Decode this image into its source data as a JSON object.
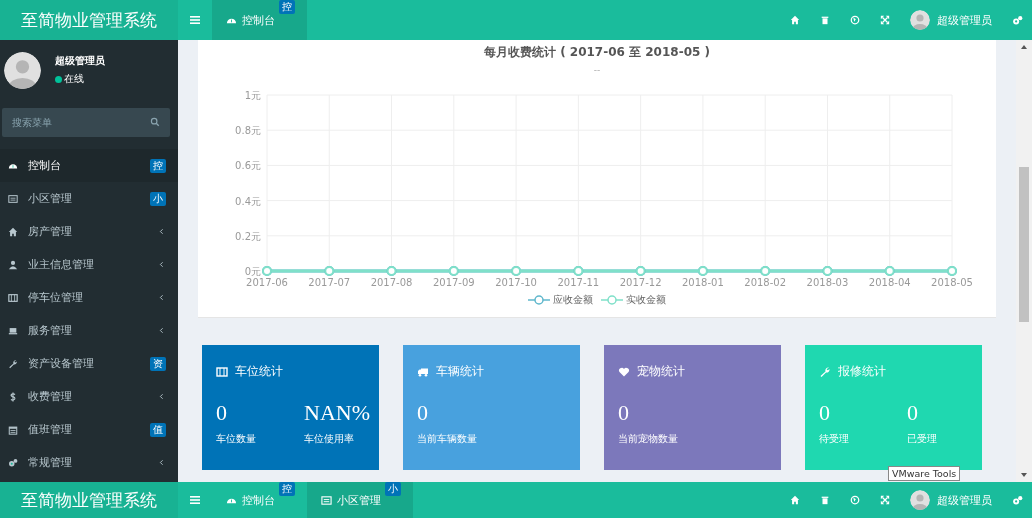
{
  "top_header": {
    "logo": "至简物业管理系统",
    "tabs": [
      {
        "label": "控制台",
        "badge": "控",
        "selected": true
      }
    ],
    "user": "超级管理员"
  },
  "sidebar": {
    "user": {
      "name": "超级管理员",
      "status": "在线"
    },
    "search": {
      "placeholder": "搜索菜单"
    },
    "items": [
      {
        "label": "控制台",
        "badge": "控",
        "expandable": false,
        "selected": true
      },
      {
        "label": "小区管理",
        "badge": "小",
        "expandable": false,
        "selected": false
      },
      {
        "label": "房产管理",
        "expandable": true,
        "selected": false
      },
      {
        "label": "业主信息管理",
        "expandable": true,
        "selected": false
      },
      {
        "label": "停车位管理",
        "expandable": true,
        "selected": false
      },
      {
        "label": "服务管理",
        "expandable": true,
        "selected": false
      },
      {
        "label": "资产设备管理",
        "badge": "资",
        "expandable": false,
        "selected": false
      },
      {
        "label": "收费管理",
        "expandable": true,
        "selected": false
      },
      {
        "label": "值班管理",
        "badge": "值",
        "expandable": false,
        "selected": false
      },
      {
        "label": "常规管理",
        "expandable": true,
        "selected": false
      }
    ]
  },
  "chart_panel": {
    "subtitle": "--",
    "chart_data": {
      "type": "line",
      "title": "每月收费统计 ( 2017-06 至 2018-05 )",
      "categories": [
        "2017-06",
        "2017-07",
        "2017-08",
        "2017-09",
        "2017-10",
        "2017-11",
        "2017-12",
        "2018-01",
        "2018-02",
        "2018-03",
        "2018-04",
        "2018-05"
      ],
      "grid": true,
      "series": [
        {
          "name": "应收金额",
          "color": "#5fb7cc",
          "marker": true,
          "values": [
            0,
            0,
            0,
            0,
            0,
            0,
            0,
            0,
            0,
            0,
            0,
            0
          ]
        },
        {
          "name": "实收金额",
          "color": "#7fe0c9",
          "marker": true,
          "values": [
            0,
            0,
            0,
            0,
            0,
            0,
            0,
            0,
            0,
            0,
            0,
            0
          ]
        }
      ],
      "ylim": [
        0,
        1
      ],
      "yticks": [
        {
          "value": 0,
          "label": "0元"
        },
        {
          "value": 0.2,
          "label": "0.2元"
        },
        {
          "value": 0.4,
          "label": "0.4元"
        },
        {
          "value": 0.6,
          "label": "0.6元"
        },
        {
          "value": 0.8,
          "label": "0.8元"
        },
        {
          "value": 1,
          "label": "1元"
        }
      ]
    }
  },
  "stat_cards": [
    {
      "title": "车位统计",
      "color": "#0073b7",
      "stats": [
        {
          "value": "0",
          "label": "车位数量"
        },
        {
          "value": "NAN%",
          "label": "车位使用率"
        }
      ]
    },
    {
      "title": "车辆统计",
      "color": "#48a1de",
      "stats": [
        {
          "value": "0",
          "label": "当前车辆数量"
        }
      ]
    },
    {
      "title": "宠物统计",
      "color": "#7c78bb",
      "stats": [
        {
          "value": "0",
          "label": "当前宠物数量"
        }
      ]
    },
    {
      "title": "报修统计",
      "color": "#1fd8b0",
      "stats": [
        {
          "value": "0",
          "label": "待受理"
        },
        {
          "value": "0",
          "label": "已受理"
        }
      ]
    }
  ],
  "tooltip": "VMware Tools",
  "bottom_header": {
    "logo": "至简物业管理系统",
    "tabs": [
      {
        "label": "控制台",
        "badge": "控",
        "selected": false
      },
      {
        "label": "小区管理",
        "badge": "小",
        "selected": true
      }
    ],
    "user": "超级管理员"
  }
}
